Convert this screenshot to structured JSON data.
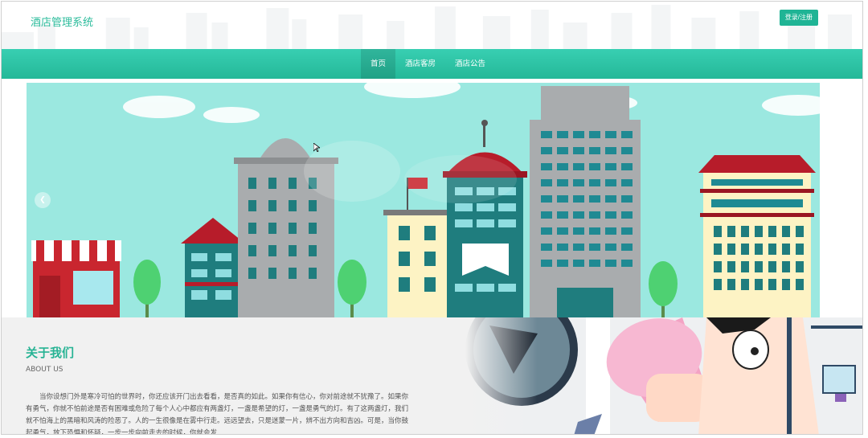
{
  "header": {
    "site_title": "酒店管理系统",
    "login_label": "登录/注册"
  },
  "nav": {
    "items": [
      {
        "label": "首页",
        "active": true
      },
      {
        "label": "酒店客房",
        "active": false
      },
      {
        "label": "酒店公告",
        "active": false
      }
    ]
  },
  "banner": {
    "prev_icon": "chevron-left-icon"
  },
  "about": {
    "title": "关于我们",
    "subtitle": "ABOUT US",
    "text": "当你设想门外是寒冷可怕的世界时，你还应该开门出去看看，是否真的如此。如果你有信心，你对前途就不犹豫了。如果你有勇气，你就不怕前途是否有困难或危险了每个人心中都应有两盏灯，一盏是希望的灯，一盏是勇气的灯。有了这两盏灯，我们就不怕海上的黑暗和风涛的险恶了。人的一生很像是在雾中行走。远远望去，只是迷蒙一片，辨不出方向和吉凶。可是，当你鼓起勇气，放下恐惧和怀疑，一步一步向前走去的时候，你就会发"
  },
  "colors": {
    "brand": "#27b394",
    "nav_top": "#38cfb2",
    "nav_bottom": "#24b898",
    "sky": "#9be8e0"
  }
}
